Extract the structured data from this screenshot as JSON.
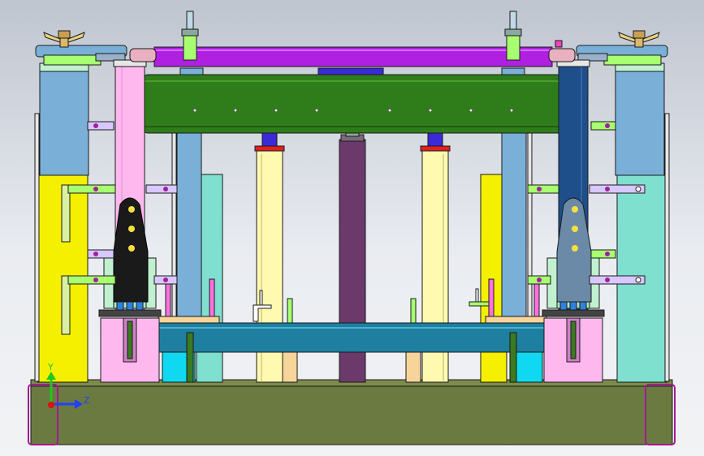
{
  "viewport": {
    "background_top": "#bfc5cf",
    "background_bottom": "#f2f3f5"
  },
  "triad": {
    "y_label": "Y",
    "z_label": "Z",
    "y_color": "#1ec81e",
    "z_color": "#2040ff",
    "origin_color": "#e01010"
  },
  "colors": {
    "edge": "#1a1a1a",
    "base_plate": "#6b7a40",
    "base_frame": "#a01a8f",
    "top_beam": "#b020e0",
    "upper_roller": "#2f7d1a",
    "lower_roller": "#1f7fa0",
    "yellow_post": "#f5f000",
    "light_blue_post": "#7ab0d8",
    "cyan_post": "#7fe0d0",
    "pink": "#ffb8ee",
    "dark_blue": "#1f4f8a",
    "center_column": "#6b3a6a",
    "cream_column": "#fffab0",
    "green_bracket": "#a8ff70",
    "lavender_bracket": "#d8c8ff",
    "black_clamp": "#1a1a1a",
    "slate_clamp": "#6a8aa8",
    "mint_block": "#c0f0d0",
    "orange_pad": "#f7d49a",
    "cyan_block": "#10d8f0"
  }
}
